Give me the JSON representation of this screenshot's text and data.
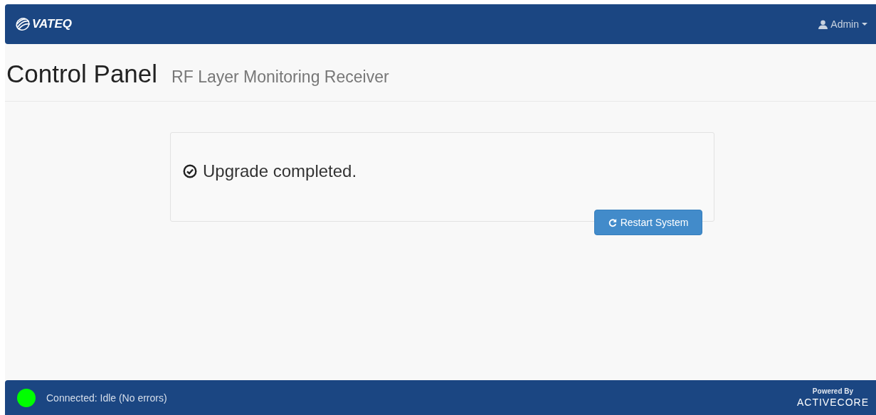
{
  "navbar": {
    "brand": "VATEQ",
    "user_menu": {
      "label": "Admin"
    }
  },
  "header": {
    "title": "Control Panel",
    "subtitle": "RF Layer Monitoring Receiver"
  },
  "panel": {
    "message": "Upgrade completed.",
    "button": "Restart System"
  },
  "footer": {
    "status": {
      "connected": true,
      "text": "Connected: Idle (No errors)"
    },
    "powered_by": "Powered By",
    "vendor": "ACTIVECORE"
  }
}
